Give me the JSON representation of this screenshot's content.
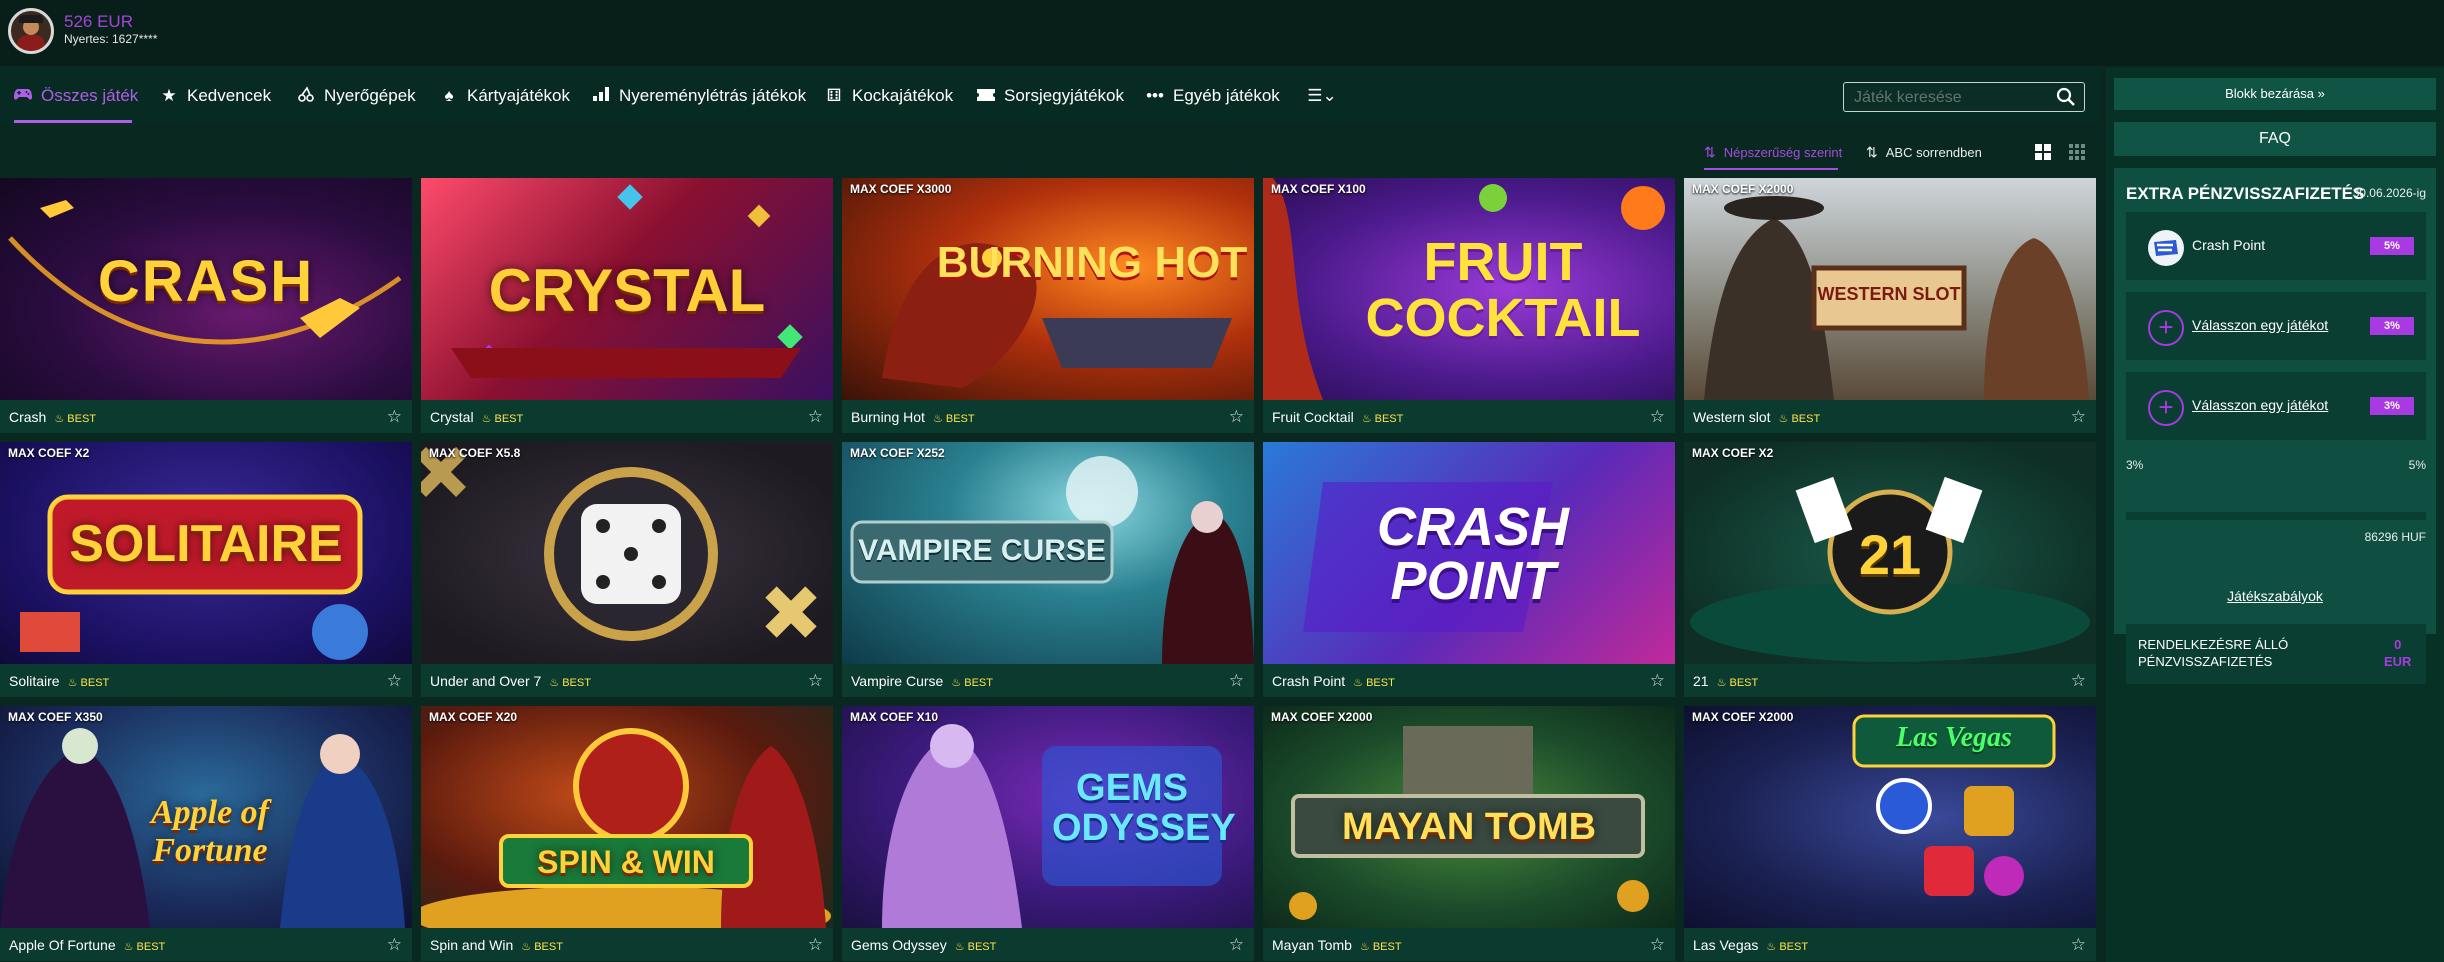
{
  "user": {
    "balance": "526 EUR",
    "winner_line": "Nyertes: 1627****"
  },
  "nav": {
    "items": [
      {
        "label": "Összes játék",
        "icon": "gamepad-icon"
      },
      {
        "label": "Kedvencek",
        "icon": "star-icon"
      },
      {
        "label": "Nyerőgépek",
        "icon": "cherry-icon"
      },
      {
        "label": "Kártyajátékok",
        "icon": "spade-icon"
      },
      {
        "label": "Nyereménylétrás játékok",
        "icon": "bars-icon"
      },
      {
        "label": "Kockajátékok",
        "icon": "dice-icon"
      },
      {
        "label": "Sorsjegyjátékok",
        "icon": "ticket-icon"
      },
      {
        "label": "Egyéb játékok",
        "icon": "dots-icon"
      }
    ],
    "more_icon": "menu-chevron-icon"
  },
  "search": {
    "placeholder": "Játék keresése"
  },
  "sort": {
    "popularity": "Népszerűség szerint",
    "abc": "ABC sorrendben"
  },
  "best_label": "BEST",
  "games": [
    {
      "name": "Crash",
      "coef": ""
    },
    {
      "name": "Crystal",
      "coef": ""
    },
    {
      "name": "Burning Hot",
      "coef": "MAX COEF X3000"
    },
    {
      "name": "Fruit Cocktail",
      "coef": "MAX COEF X100"
    },
    {
      "name": "Western slot",
      "coef": "MAX COEF X2000"
    },
    {
      "name": "Solitaire",
      "coef": "MAX COEF X2"
    },
    {
      "name": "Under and Over 7",
      "coef": "MAX COEF X5.8"
    },
    {
      "name": "Vampire Curse",
      "coef": "MAX COEF X252"
    },
    {
      "name": "Crash Point",
      "coef": ""
    },
    {
      "name": "21",
      "coef": "MAX COEF X2"
    },
    {
      "name": "Apple Of Fortune",
      "coef": "MAX COEF X350"
    },
    {
      "name": "Spin and Win",
      "coef": "MAX COEF X20"
    },
    {
      "name": "Gems Odyssey",
      "coef": "MAX COEF X10"
    },
    {
      "name": "Mayan Tomb",
      "coef": "MAX COEF X2000"
    },
    {
      "name": "Las Vegas",
      "coef": "MAX COEF X2000"
    }
  ],
  "art_titles": [
    "CRASH",
    "CRYSTAL",
    "BURNING HOT",
    "FRUIT COCKTAIL",
    "WESTERN SLOT",
    "SOLITAIRE",
    "",
    "VAMPIRE CURSE",
    "CRASH POINT",
    "21",
    "Apple of Fortune",
    "SPIN & WIN",
    "GEMS ODYSSEY",
    "MAYAN TOMB",
    "Las Vegas"
  ],
  "sidebar": {
    "close_block": "Blokk bezárása",
    "faq": "FAQ",
    "panel_title": "EXTRA PÉNZVISSZAFIZETÉS",
    "date": "30.06.2026-ig",
    "cashback": [
      {
        "label": "Crash Point",
        "pct": "5%"
      },
      {
        "label": "Válasszon egy játékot",
        "pct": "3%"
      },
      {
        "label": "Válasszon egy játékot",
        "pct": "3%"
      }
    ],
    "progress_min": "3%",
    "progress_max": "5%",
    "progress_amount": "86296 HUF",
    "rules": "Játékszabályok",
    "available_label": "RENDELKEZÉSRE ÁLLÓ PÉNZVISSZAFIZETÉS",
    "available_value": "0",
    "available_currency": "EUR"
  },
  "colors": {
    "accent": "#a73ae0",
    "best": "#ffe34a",
    "bg": "#082820"
  }
}
